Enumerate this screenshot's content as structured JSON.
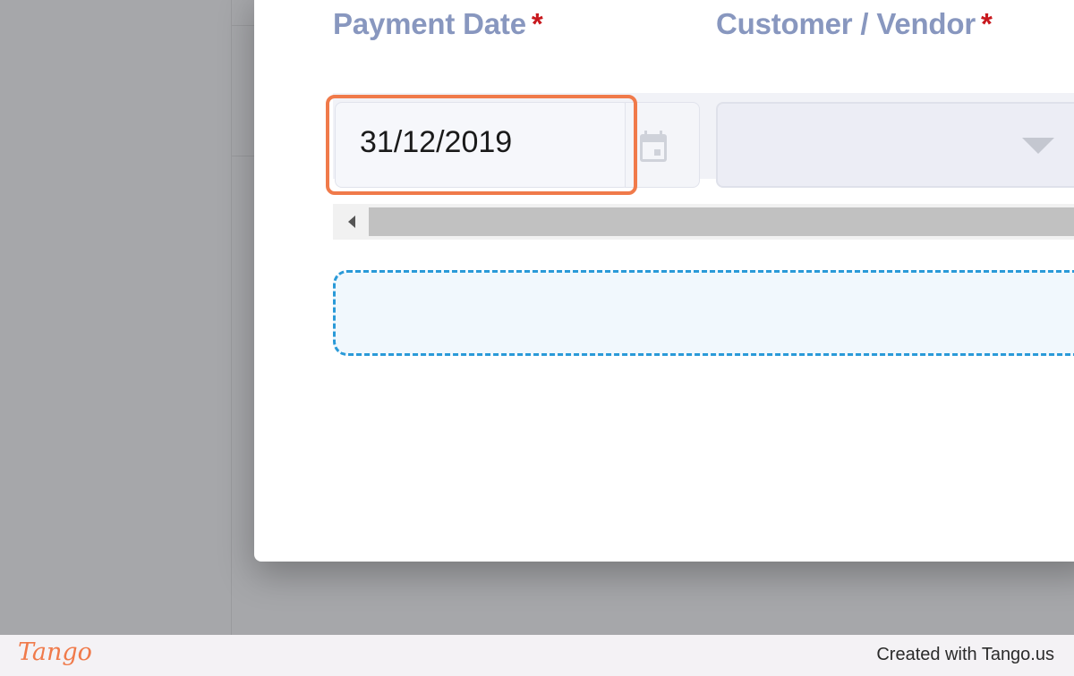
{
  "form": {
    "payment_date": {
      "label": "Payment Date",
      "required_marker": "*",
      "value": "31/12/2019"
    },
    "customer_vendor": {
      "label": "Customer / Vendor",
      "required_marker": "*",
      "value": ""
    }
  },
  "icons": {
    "calendar": "calendar-icon",
    "dropdown": "caret-down-icon",
    "scroll_left": "caret-left-icon"
  },
  "colors": {
    "highlight": "#f07a4a",
    "label": "#8897bf",
    "required": "#c8191e",
    "dropzone_border": "#2a9ad8"
  },
  "footer": {
    "logo": "Tango",
    "credit": "Created with Tango.us"
  }
}
